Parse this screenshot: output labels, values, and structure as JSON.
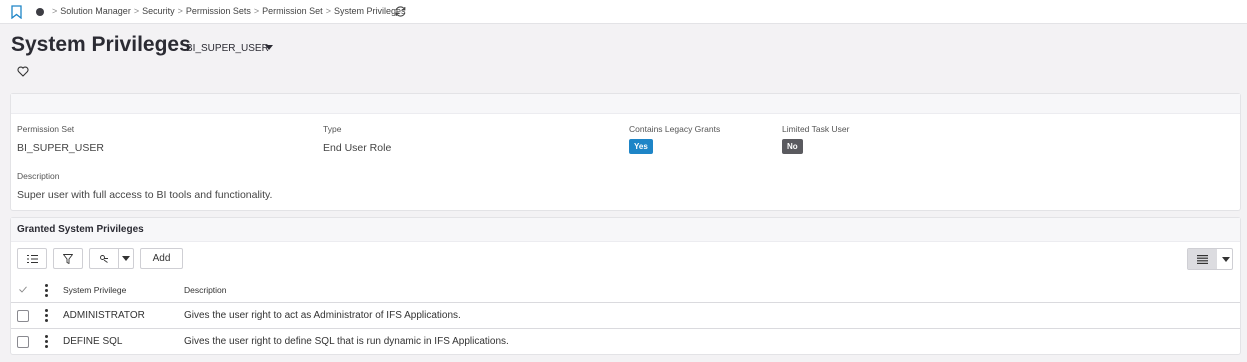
{
  "breadcrumb": {
    "items": [
      "Solution Manager",
      "Security",
      "Permission Sets",
      "Permission Set",
      "System Privileges"
    ],
    "separator": ">"
  },
  "page": {
    "title": "System Privileges",
    "subtitle": "BI_SUPER_USER"
  },
  "details": {
    "permission_set_label": "Permission Set",
    "permission_set_value": "BI_SUPER_USER",
    "type_label": "Type",
    "type_value": "End User Role",
    "legacy_label": "Contains Legacy Grants",
    "legacy_value": "Yes",
    "limited_label": "Limited Task User",
    "limited_value": "No",
    "description_label": "Description",
    "description_value": "Super user with full access to BI tools and functionality."
  },
  "list": {
    "title": "Granted System Privileges",
    "add_label": "Add",
    "columns": [
      "System Privilege",
      "Description"
    ],
    "rows": [
      {
        "privilege": "ADMINISTRATOR",
        "description": "Gives the user right to act as Administrator of IFS Applications."
      },
      {
        "privilege": "DEFINE SQL",
        "description": "Gives the user right to define SQL that is run dynamic in IFS Applications."
      }
    ]
  },
  "colors": {
    "yes_badge": "#1e85c7",
    "no_badge": "#5a5a5f",
    "background": "#f3f2f4"
  },
  "icons": [
    "bookmark-icon",
    "home-dot-icon",
    "refresh-icon",
    "heart-icon",
    "column-chooser-icon",
    "filter-icon",
    "group-icon",
    "list-view-icon",
    "check-icon",
    "more-vertical-icon"
  ]
}
